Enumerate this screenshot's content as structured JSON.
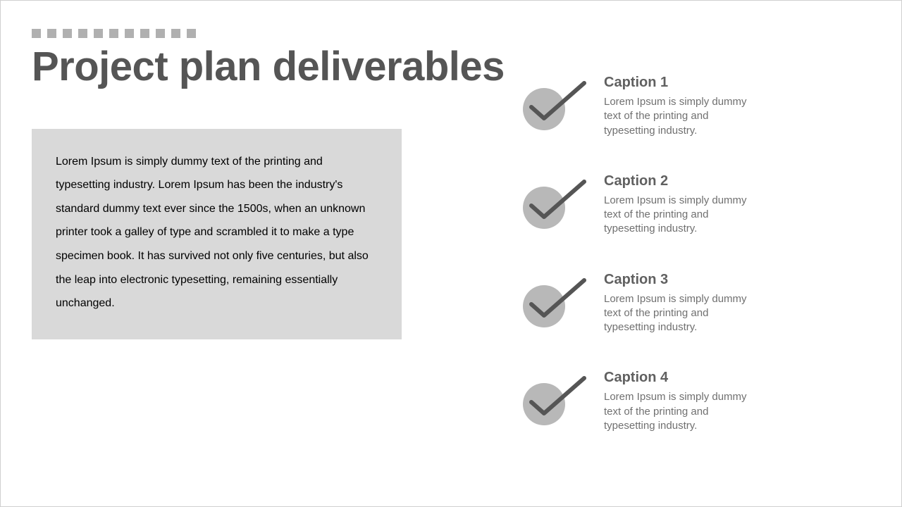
{
  "title": "Project plan deliverables",
  "description": "Lorem Ipsum is simply dummy text of the printing and typesetting industry. Lorem Ipsum has been the industry's standard dummy text ever since the 1500s, when an unknown printer took a galley of type and scrambled it to make a type specimen book. It has survived not only five centuries, but also the leap into electronic typesetting, remaining essentially unchanged.",
  "items": [
    {
      "title": "Caption 1",
      "body": "Lorem Ipsum is simply dummy text of the printing and typesetting industry."
    },
    {
      "title": "Caption 2",
      "body": "Lorem Ipsum is simply dummy text of the printing and typesetting industry."
    },
    {
      "title": "Caption 3",
      "body": "Lorem Ipsum is simply dummy text of the printing and typesetting industry."
    },
    {
      "title": "Caption 4",
      "body": "Lorem Ipsum is simply dummy text of the printing and typesetting industry."
    }
  ]
}
